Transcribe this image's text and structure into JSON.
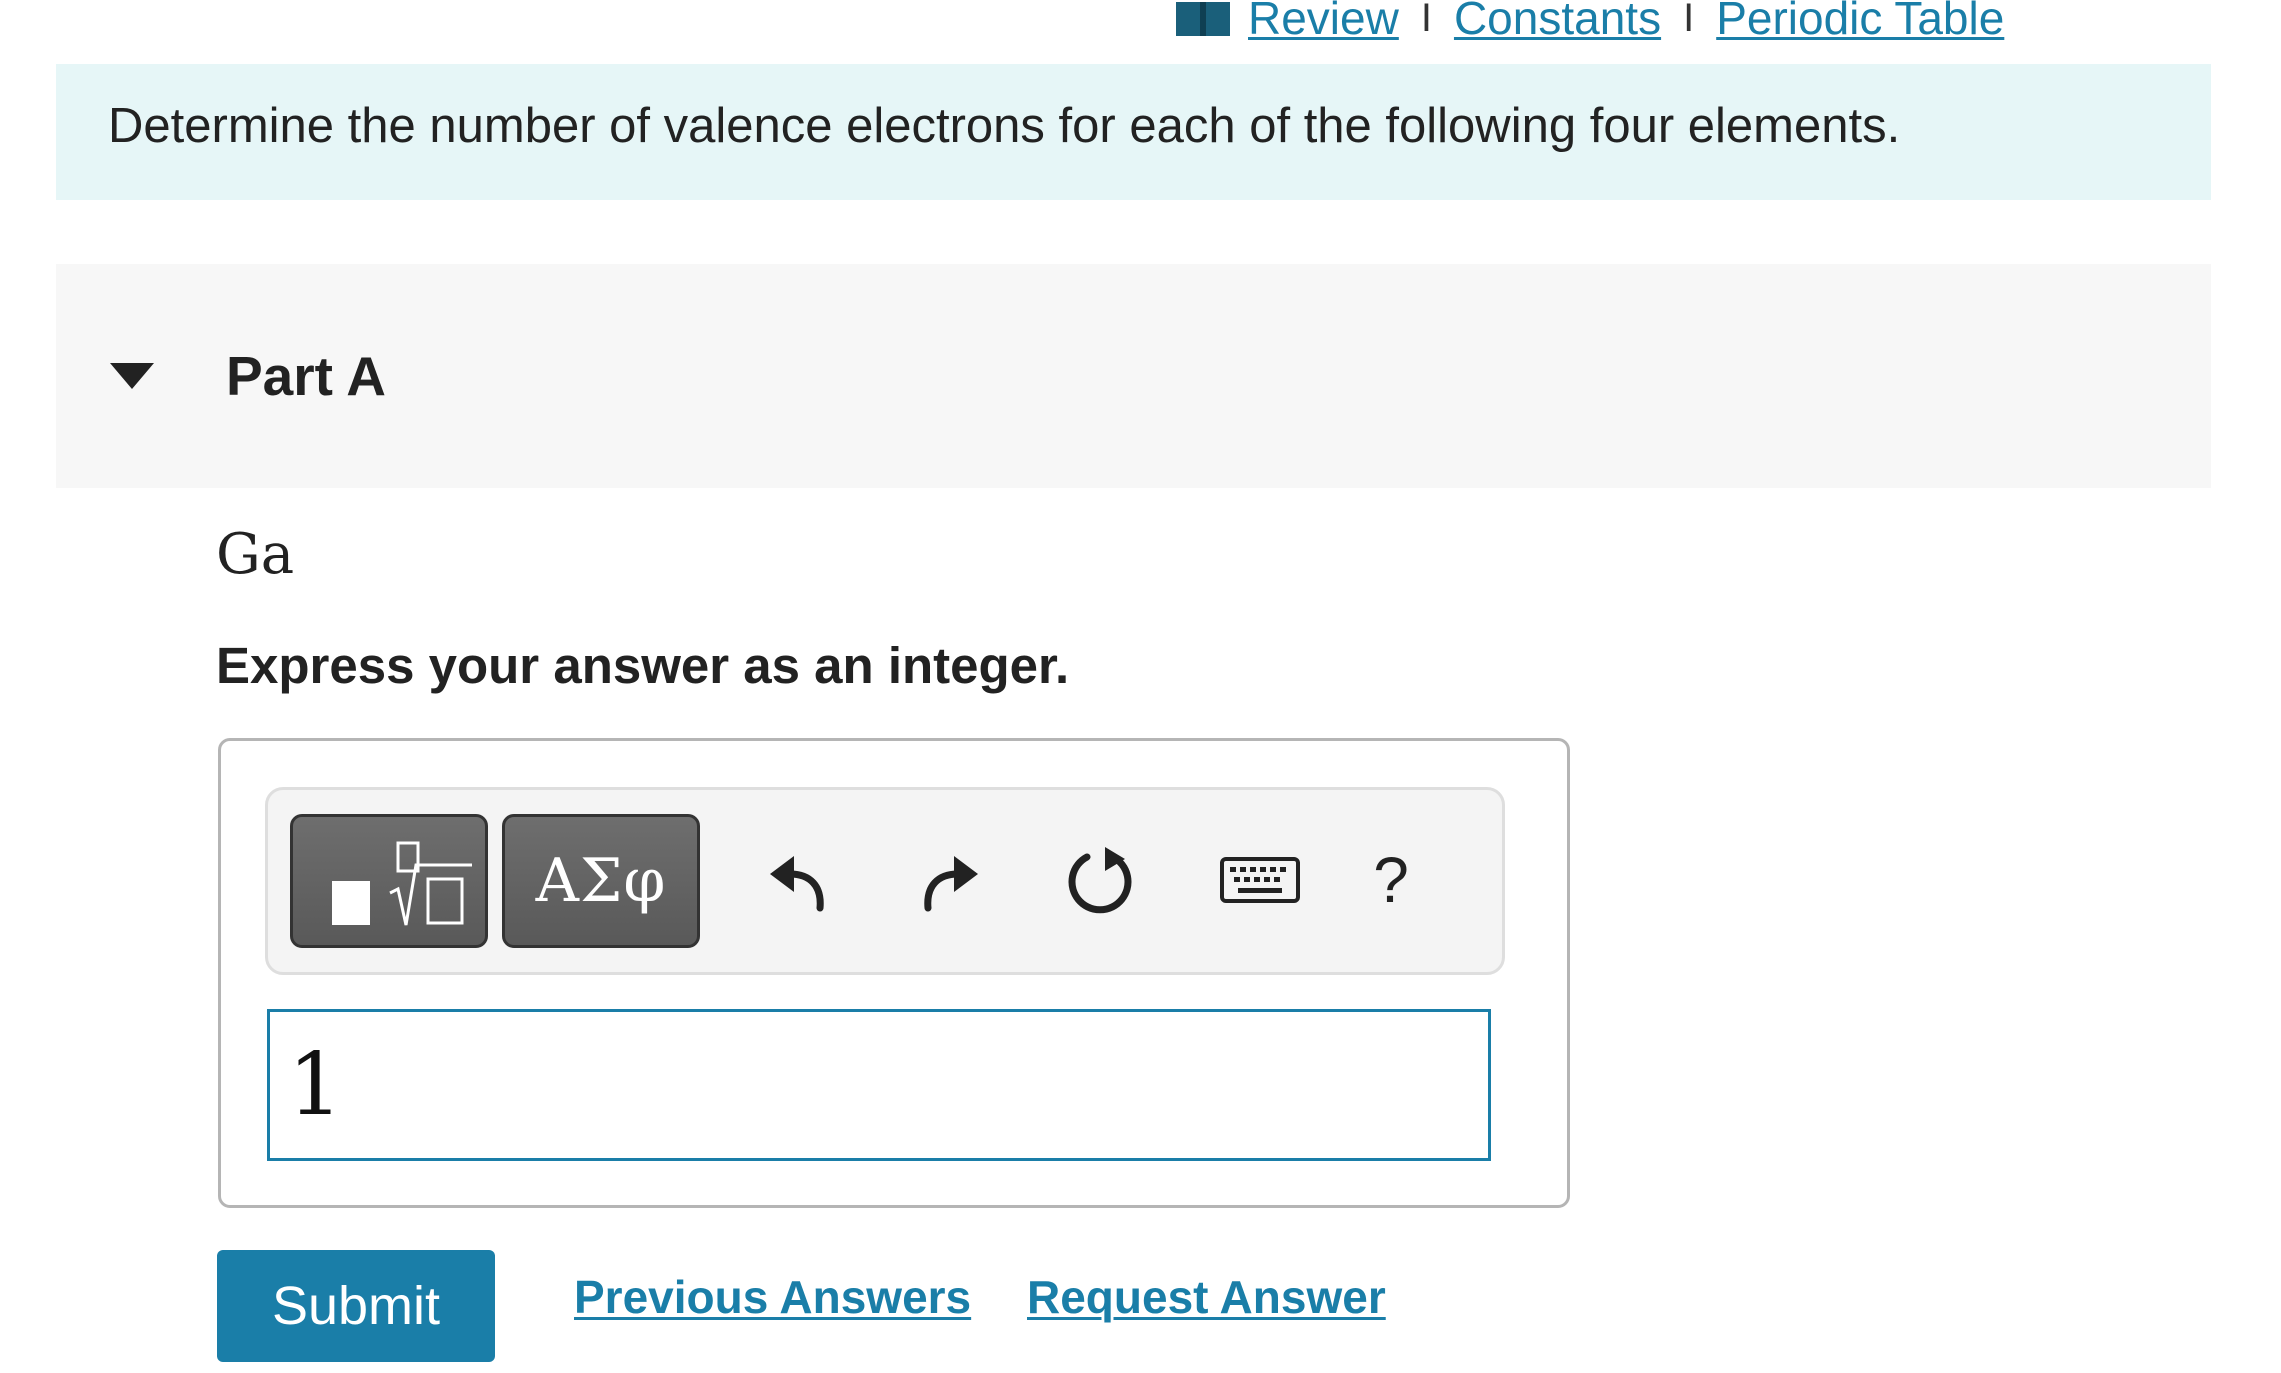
{
  "top_links": {
    "review": "Review",
    "separator": "I",
    "constants": "Constants",
    "periodic_table": "Periodic Table"
  },
  "intro": {
    "text": "Determine the number of valence electrons for each of the following four elements."
  },
  "part": {
    "title": "Part A",
    "element": "Ga",
    "instruction": "Express your answer as an integer."
  },
  "toolbar": {
    "symbols_label": "ΑΣφ",
    "help_label": "?"
  },
  "answer": {
    "value": "1"
  },
  "actions": {
    "submit": "Submit",
    "previous_answers": "Previous Answers",
    "request_answer": "Request Answer"
  },
  "colors": {
    "accent": "#1a7ea8",
    "intro_bg": "#e6f6f7",
    "part_bg": "#f7f7f7",
    "toolbar_btn": "#626262"
  }
}
